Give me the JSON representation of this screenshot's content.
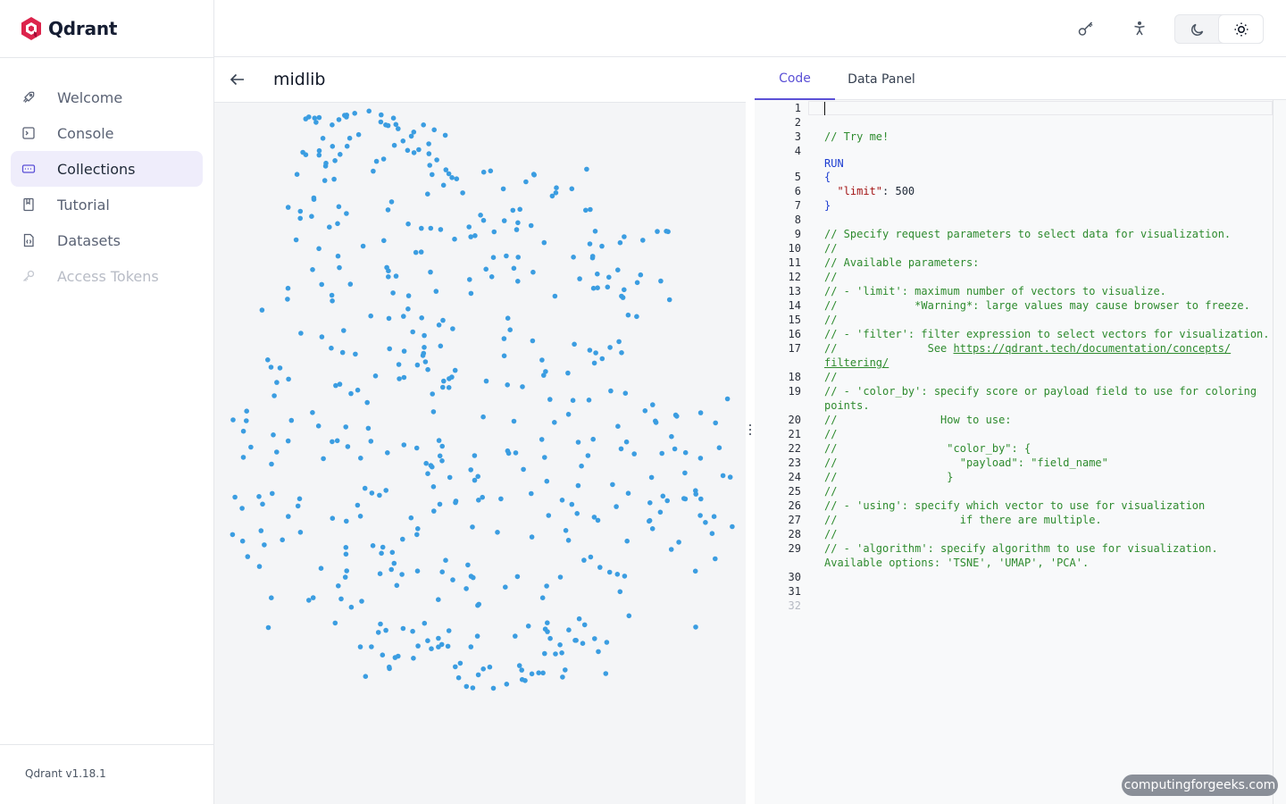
{
  "app": {
    "name": "Qdrant",
    "version": "Qdrant v1.18.1",
    "accent": "#5b50d6"
  },
  "sidebar": {
    "items": [
      {
        "label": "Welcome",
        "icon": "rocket-icon",
        "state": "normal"
      },
      {
        "label": "Console",
        "icon": "terminal-icon",
        "state": "normal"
      },
      {
        "label": "Collections",
        "icon": "collections-icon",
        "state": "active"
      },
      {
        "label": "Tutorial",
        "icon": "book-icon",
        "state": "normal"
      },
      {
        "label": "Datasets",
        "icon": "dataset-file-icon",
        "state": "normal"
      },
      {
        "label": "Access Tokens",
        "icon": "key-icon",
        "state": "disabled"
      }
    ]
  },
  "topbar": {
    "icons": [
      "api-key-icon",
      "accessibility-icon"
    ],
    "theme": {
      "options": [
        "moon-icon",
        "sun-icon"
      ],
      "selected": "light"
    }
  },
  "collection": {
    "name": "midlib"
  },
  "visualization": {
    "point_color": "#3b9de1",
    "point_count": 500
  },
  "tabs": [
    {
      "label": "Code",
      "active": true
    },
    {
      "label": "Data Panel",
      "active": false
    }
  ],
  "editor": {
    "lines": [
      {
        "n": "1",
        "segs": []
      },
      {
        "n": "2",
        "segs": []
      },
      {
        "n": "3",
        "segs": [
          {
            "t": "// Try me!",
            "c": "cmt"
          }
        ]
      },
      {
        "n": "4",
        "segs": []
      },
      {
        "n": "",
        "segs": [
          {
            "t": "RUN",
            "c": "kw"
          }
        ]
      },
      {
        "n": "5",
        "segs": [
          {
            "t": "{",
            "c": "kw"
          }
        ]
      },
      {
        "n": "6",
        "segs": [
          {
            "t": "  ",
            "c": ""
          },
          {
            "t": "\"limit\"",
            "c": "str"
          },
          {
            "t": ": ",
            "c": ""
          },
          {
            "t": "500",
            "c": ""
          }
        ]
      },
      {
        "n": "7",
        "segs": [
          {
            "t": "}",
            "c": "kw"
          }
        ]
      },
      {
        "n": "8",
        "segs": []
      },
      {
        "n": "9",
        "segs": [
          {
            "t": "// Specify request parameters to select data for visualization.",
            "c": "cmt"
          }
        ]
      },
      {
        "n": "10",
        "segs": [
          {
            "t": "//",
            "c": "cmt"
          }
        ]
      },
      {
        "n": "11",
        "segs": [
          {
            "t": "// Available parameters:",
            "c": "cmt"
          }
        ]
      },
      {
        "n": "12",
        "segs": [
          {
            "t": "//",
            "c": "cmt"
          }
        ]
      },
      {
        "n": "13",
        "segs": [
          {
            "t": "// - 'limit': maximum number of vectors to visualize.",
            "c": "cmt"
          }
        ]
      },
      {
        "n": "14",
        "segs": [
          {
            "t": "//            *Warning*: large values may cause browser to freeze.",
            "c": "cmt"
          }
        ]
      },
      {
        "n": "15",
        "segs": [
          {
            "t": "//",
            "c": "cmt"
          }
        ]
      },
      {
        "n": "16",
        "segs": [
          {
            "t": "// - 'filter': filter expression to select vectors for visualization.",
            "c": "cmt"
          }
        ]
      },
      {
        "n": "17",
        "segs": [
          {
            "t": "//              See ",
            "c": "cmt"
          },
          {
            "t": "https://qdrant.tech/documentation/concepts/",
            "c": "link"
          }
        ]
      },
      {
        "n": "",
        "segs": [
          {
            "t": "filtering/",
            "c": "link"
          }
        ]
      },
      {
        "n": "18",
        "segs": [
          {
            "t": "//",
            "c": "cmt"
          }
        ]
      },
      {
        "n": "19",
        "segs": [
          {
            "t": "// - 'color_by': specify score or payload field to use for coloring",
            "c": "cmt"
          }
        ]
      },
      {
        "n": "",
        "segs": [
          {
            "t": "points.",
            "c": "cmt"
          }
        ]
      },
      {
        "n": "20",
        "segs": [
          {
            "t": "//                How to use:",
            "c": "cmt"
          }
        ]
      },
      {
        "n": "21",
        "segs": [
          {
            "t": "//",
            "c": "cmt"
          }
        ]
      },
      {
        "n": "22",
        "segs": [
          {
            "t": "//                 \"color_by\": {",
            "c": "cmt"
          }
        ]
      },
      {
        "n": "23",
        "segs": [
          {
            "t": "//                   \"payload\": \"field_name\"",
            "c": "cmt"
          }
        ]
      },
      {
        "n": "24",
        "segs": [
          {
            "t": "//                 }",
            "c": "cmt"
          }
        ]
      },
      {
        "n": "25",
        "segs": [
          {
            "t": "//",
            "c": "cmt"
          }
        ]
      },
      {
        "n": "26",
        "segs": [
          {
            "t": "// - 'using': specify which vector to use for visualization",
            "c": "cmt"
          }
        ]
      },
      {
        "n": "27",
        "segs": [
          {
            "t": "//                   if there are multiple.",
            "c": "cmt"
          }
        ]
      },
      {
        "n": "28",
        "segs": [
          {
            "t": "//",
            "c": "cmt"
          }
        ]
      },
      {
        "n": "29",
        "segs": [
          {
            "t": "// - 'algorithm': specify algorithm to use for visualization.",
            "c": "cmt"
          }
        ]
      },
      {
        "n": "",
        "segs": [
          {
            "t": "Available options: 'TSNE', 'UMAP', 'PCA'.",
            "c": "cmt"
          }
        ]
      },
      {
        "n": "30",
        "segs": []
      },
      {
        "n": "31",
        "segs": []
      },
      {
        "n": "32",
        "segs": [],
        "dim": true
      }
    ]
  },
  "watermark": "computingforgeeks.com"
}
